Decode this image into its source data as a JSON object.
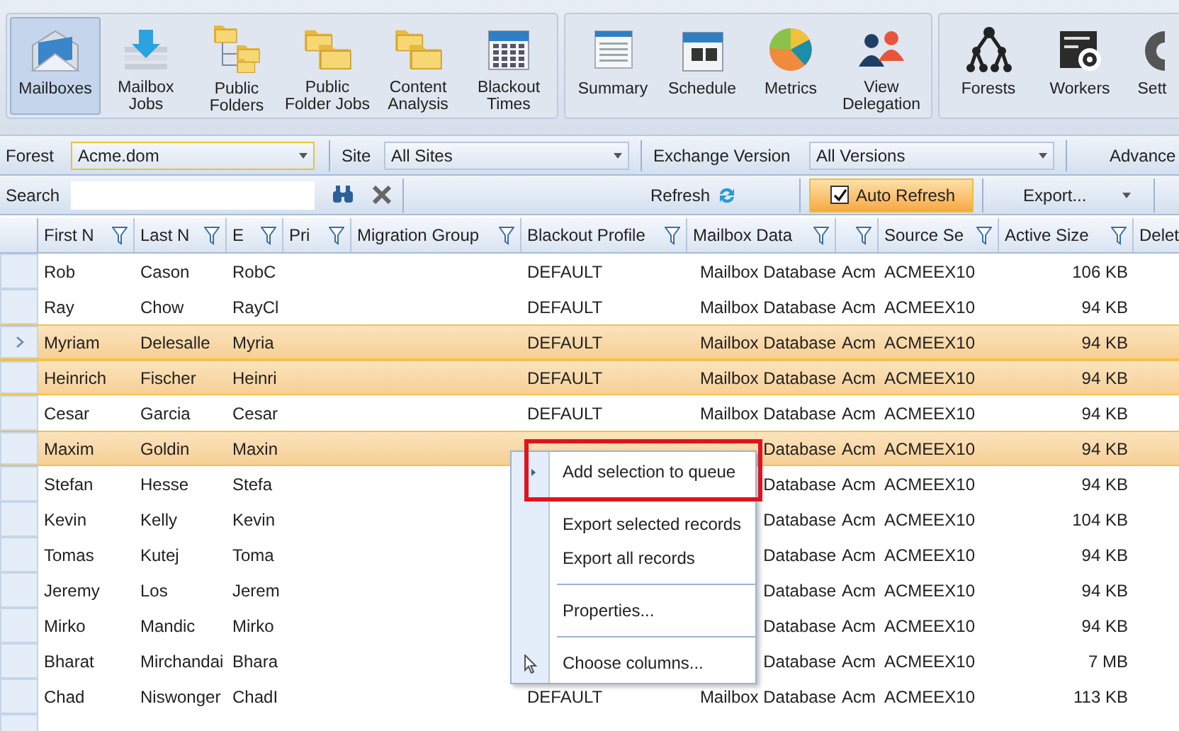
{
  "ribbon": {
    "groups": [
      {
        "buttons": [
          {
            "label": "Mailboxes",
            "selected": true
          },
          {
            "label": "Mailbox Jobs",
            "selected": false
          },
          {
            "label": "Public Folders",
            "selected": false
          },
          {
            "label": "Public Folder Jobs",
            "selected": false
          },
          {
            "label": "Content Analysis",
            "selected": false
          },
          {
            "label": "Blackout Times",
            "selected": false
          }
        ]
      },
      {
        "buttons": [
          {
            "label": "Summary",
            "selected": false
          },
          {
            "label": "Schedule",
            "selected": false
          },
          {
            "label": "Metrics",
            "selected": false
          },
          {
            "label": "View Delegation",
            "selected": false
          }
        ]
      },
      {
        "buttons": [
          {
            "label": "Forests",
            "selected": false
          },
          {
            "label": "Workers",
            "selected": false
          },
          {
            "label": "Sett",
            "selected": false
          }
        ]
      }
    ]
  },
  "filter_bar": {
    "forest_label": "Forest",
    "forest_value": "Acme.dom",
    "site_label": "Site",
    "site_value": "All Sites",
    "exchange_label": "Exchange Version",
    "exchange_value": "All Versions",
    "advanced_button": "Advance"
  },
  "search_bar": {
    "label": "Search",
    "refresh_button": "Refresh",
    "auto_refresh": {
      "label": "Auto Refresh",
      "checked": true
    },
    "export_button": "Export..."
  },
  "table": {
    "columns": [
      "First N",
      "Last N",
      "E",
      "Pri",
      "Migration Group",
      "Blackout Profile",
      "Mailbox Data",
      "",
      "Source Se",
      "Active Size",
      "Delet"
    ],
    "rows": [
      {
        "first_name": "Rob",
        "last_name": "Cason",
        "email": "RobC",
        "blackout_profile": "DEFAULT",
        "mailbox_database": "Mailbox Database",
        "column_8": "Acm",
        "source_server": "ACMEEX10",
        "active_size": "106 KB",
        "selected": false,
        "current": false
      },
      {
        "first_name": "Ray",
        "last_name": "Chow",
        "email": "RayCl",
        "blackout_profile": "DEFAULT",
        "mailbox_database": "Mailbox Database",
        "column_8": "Acm",
        "source_server": "ACMEEX10",
        "active_size": "94 KB",
        "selected": false,
        "current": false
      },
      {
        "first_name": "Myriam",
        "last_name": "Delesalle",
        "email": "Myria",
        "blackout_profile": "DEFAULT",
        "mailbox_database": "Mailbox Database",
        "column_8": "Acm",
        "source_server": "ACMEEX10",
        "active_size": "94 KB",
        "selected": true,
        "current": true
      },
      {
        "first_name": "Heinrich",
        "last_name": "Fischer",
        "email": "Heinri",
        "blackout_profile": "DEFAULT",
        "mailbox_database": "Mailbox Database",
        "column_8": "Acm",
        "source_server": "ACMEEX10",
        "active_size": "94 KB",
        "selected": true,
        "current": false
      },
      {
        "first_name": "Cesar",
        "last_name": "Garcia",
        "email": "Cesar",
        "blackout_profile": "DEFAULT",
        "mailbox_database": "Mailbox Database",
        "column_8": "Acm",
        "source_server": "ACMEEX10",
        "active_size": "94 KB",
        "selected": false,
        "current": false
      },
      {
        "first_name": "Maxim",
        "last_name": "Goldin",
        "email": "Maxin",
        "mailbox_database": "Database",
        "column_8": "Acm",
        "source_server": "ACMEEX10",
        "active_size": "94 KB",
        "selected": true,
        "current": false
      },
      {
        "first_name": "Stefan",
        "last_name": "Hesse",
        "email": "Stefa",
        "mailbox_database": "Database",
        "column_8": "Acm",
        "source_server": "ACMEEX10",
        "active_size": "94 KB",
        "selected": false,
        "current": false
      },
      {
        "first_name": "Kevin",
        "last_name": "Kelly",
        "email": "Kevin",
        "mailbox_database": "Database",
        "column_8": "Acm",
        "source_server": "ACMEEX10",
        "active_size": "104 KB",
        "selected": false,
        "current": false
      },
      {
        "first_name": "Tomas",
        "last_name": "Kutej",
        "email": "Toma",
        "mailbox_database": "Database",
        "column_8": "Acm",
        "source_server": "ACMEEX10",
        "active_size": "94 KB",
        "selected": false,
        "current": false
      },
      {
        "first_name": "Jeremy",
        "last_name": "Los",
        "email": "Jerem",
        "mailbox_database": "Database",
        "column_8": "Acm",
        "source_server": "ACMEEX10",
        "active_size": "94 KB",
        "selected": false,
        "current": false
      },
      {
        "first_name": "Mirko",
        "last_name": "Mandic",
        "email": "Mirko",
        "mailbox_database": "Database",
        "column_8": "Acm",
        "source_server": "ACMEEX10",
        "active_size": "94 KB",
        "selected": false,
        "current": false
      },
      {
        "first_name": "Bharat",
        "last_name": "Mirchandai",
        "email": "Bhara",
        "mailbox_database": "Database",
        "column_8": "Acm",
        "source_server": "ACMEEX10",
        "active_size": "7 MB",
        "selected": false,
        "current": false
      },
      {
        "first_name": "Chad",
        "last_name": "Niswonger",
        "email": "ChadI",
        "blackout_profile": "DEFAULT",
        "mailbox_database": "Mailbox Database",
        "column_8": "Acm",
        "source_server": "ACMEEX10",
        "active_size": "113 KB",
        "selected": false,
        "current": false
      }
    ]
  },
  "context_menu": {
    "items": [
      {
        "kind": "item",
        "label": "Add selection to queue",
        "highlighted": true
      },
      {
        "kind": "separator"
      },
      {
        "kind": "item",
        "label": "Export selected records",
        "highlighted": false
      },
      {
        "kind": "item",
        "label": "Export all records",
        "highlighted": false
      },
      {
        "kind": "separator"
      },
      {
        "kind": "item",
        "label": "Properties...",
        "highlighted": false
      },
      {
        "kind": "separator"
      },
      {
        "kind": "item",
        "label": "Choose columns...",
        "highlighted": false
      }
    ]
  }
}
